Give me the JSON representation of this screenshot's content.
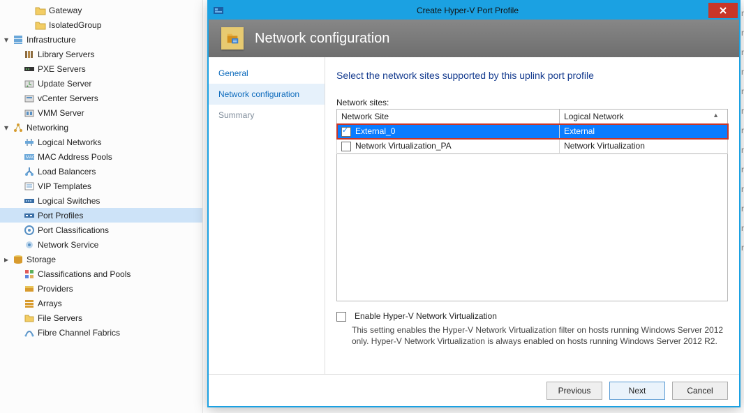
{
  "tree": [
    {
      "label": "Gateway",
      "depth": 2,
      "icon": "folder"
    },
    {
      "label": "IsolatedGroup",
      "depth": 2,
      "icon": "folder"
    },
    {
      "label": "Infrastructure",
      "depth": 0,
      "icon": "server",
      "expander": "open"
    },
    {
      "label": "Library Servers",
      "depth": 1,
      "icon": "library"
    },
    {
      "label": "PXE Servers",
      "depth": 1,
      "icon": "pxe"
    },
    {
      "label": "Update Server",
      "depth": 1,
      "icon": "update"
    },
    {
      "label": "vCenter Servers",
      "depth": 1,
      "icon": "vcenter"
    },
    {
      "label": "VMM Server",
      "depth": 1,
      "icon": "vmm"
    },
    {
      "label": "Networking",
      "depth": 0,
      "icon": "network",
      "expander": "open"
    },
    {
      "label": "Logical Networks",
      "depth": 1,
      "icon": "logicalnet"
    },
    {
      "label": "MAC Address Pools",
      "depth": 1,
      "icon": "mac"
    },
    {
      "label": "Load Balancers",
      "depth": 1,
      "icon": "loadbal"
    },
    {
      "label": "VIP Templates",
      "depth": 1,
      "icon": "vip"
    },
    {
      "label": "Logical Switches",
      "depth": 1,
      "icon": "switch"
    },
    {
      "label": "Port Profiles",
      "depth": 1,
      "icon": "portprofile",
      "selected": true
    },
    {
      "label": "Port Classifications",
      "depth": 1,
      "icon": "portclass"
    },
    {
      "label": "Network Service",
      "depth": 1,
      "icon": "service"
    },
    {
      "label": "Storage",
      "depth": 0,
      "icon": "storage",
      "expander": "closed"
    },
    {
      "label": "Classifications and Pools",
      "depth": 1,
      "icon": "classpool"
    },
    {
      "label": "Providers",
      "depth": 1,
      "icon": "providers"
    },
    {
      "label": "Arrays",
      "depth": 1,
      "icon": "arrays"
    },
    {
      "label": "File Servers",
      "depth": 1,
      "icon": "fileservers"
    },
    {
      "label": "Fibre Channel Fabrics",
      "depth": 1,
      "icon": "fibre"
    }
  ],
  "dialog": {
    "title": "Create Hyper-V Port Profile",
    "banner": "Network configuration",
    "steps": [
      "General",
      "Network configuration",
      "Summary"
    ],
    "activeStep": 1,
    "instruction": "Select the network sites supported by this uplink port profile",
    "sitesLabel": "Network sites:",
    "columns": [
      "Network Site",
      "Logical Network"
    ],
    "rows": [
      {
        "site": "External_0",
        "network": "External",
        "checked": true,
        "selected": true
      },
      {
        "site": "Network Virtualization_PA",
        "network": "Network Virtualization",
        "checked": false,
        "selected": false
      }
    ],
    "enable": {
      "label": "Enable Hyper-V Network Virtualization",
      "checked": false,
      "hint": "This setting enables the Hyper-V Network Virtualization filter on hosts running Windows Server 2012 only. Hyper-V Network Virtualization is always enabled on hosts running Windows Server 2012 R2."
    },
    "buttons": {
      "previous": "Previous",
      "next": "Next",
      "cancel": "Cancel"
    }
  }
}
